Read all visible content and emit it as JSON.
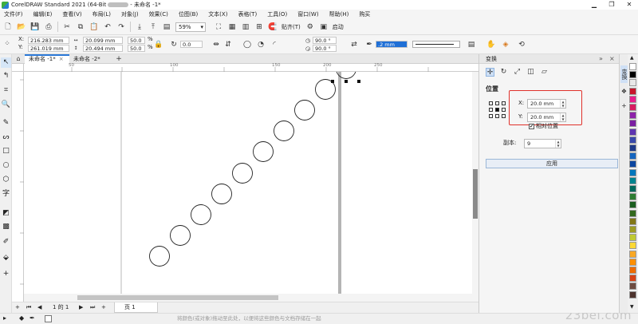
{
  "window": {
    "title_prefix": "CorelDRAW Standard 2021 (64-Bit",
    "title_suffix": "- 未命名 -1*",
    "minimize": "▁",
    "restore": "❐",
    "close": "✕"
  },
  "menu": [
    "文件(F)",
    "编辑(E)",
    "查看(V)",
    "布局(L)",
    "对象(J)",
    "效果(C)",
    "位图(B)",
    "文本(X)",
    "表格(T)",
    "工具(O)",
    "窗口(W)",
    "帮助(H)",
    "购买"
  ],
  "toolbar": {
    "zoom": "59%",
    "snap_label": "贴齐(T)",
    "launch_label": "启动"
  },
  "propbar": {
    "x_label": "X:",
    "x": "216.283 mm",
    "y_label": "Y:",
    "y": "261.019 mm",
    "w": "20.099 mm",
    "h": "20.494 mm",
    "scale_w": "50.0",
    "scale_h": "50.0",
    "pct": "%",
    "rotation": "0.0",
    "angle1": "90.0 °",
    "angle2": "90.0 °",
    "outline": ".2 mm"
  },
  "tabs": [
    "未命名 -1*",
    "未命名 -2*"
  ],
  "ruler": {
    "h_ticks": [
      "50",
      "100",
      "150",
      "200",
      "250"
    ]
  },
  "page_nav": {
    "page_info": "1 的 1",
    "page_tab": "页 1"
  },
  "status": {
    "hint": "将颜色(或对象)拖动至此处，以便将这些颜色与文档存储在一起"
  },
  "watermark": "23bei.com",
  "docker": {
    "title": "变换",
    "section": "位置",
    "x_label": "X:",
    "x_value": "20.0 mm",
    "y_label": "Y:",
    "y_value": "20.0 mm",
    "relative_label": "相对位置",
    "relative_checked": true,
    "copies_label": "副本:",
    "copies_value": "9",
    "apply_label": "应用"
  },
  "side_tabs": [
    "变换"
  ],
  "palette_colors": [
    "#ffffff",
    "#000000",
    "#e8e8e8",
    "#c8162c",
    "#e91e8c",
    "#d81b60",
    "#8e24aa",
    "#7b1fa2",
    "#5e35b1",
    "#3949ab",
    "#1e3a8a",
    "#1565c0",
    "#0d47a1",
    "#0277bd",
    "#00838f",
    "#00695c",
    "#2e7d32",
    "#1b5e20",
    "#33691e",
    "#827717",
    "#9e9d24",
    "#c0ca33",
    "#fdd835",
    "#f9a825",
    "#ff8f00",
    "#ef6c00",
    "#d84315",
    "#6d4c41",
    "#4e342e"
  ]
}
